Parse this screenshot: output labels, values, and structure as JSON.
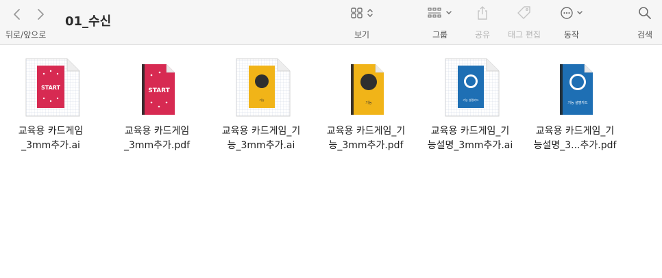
{
  "toolbar": {
    "nav_label": "뒤로/앞으로",
    "folder_title": "01_수신",
    "view_label": "보기",
    "group_label": "그룹",
    "share_label": "공유",
    "tags_label": "태그 편집",
    "action_label": "동작",
    "search_label": "검색"
  },
  "files": [
    {
      "line1": "교육용 카드게임",
      "line2": "_3mm추가.ai",
      "kind": "ai",
      "card_color": "#d72a52",
      "card_text": "START"
    },
    {
      "line1": "교육용 카드게임",
      "line2": "_3mm추가.pdf",
      "kind": "pdf",
      "card_color": "#d72a52",
      "card_text": "START"
    },
    {
      "line1": "교육용 카드게임_기",
      "line2": "능_3mm추가.ai",
      "kind": "ai",
      "card_color": "#f1b418",
      "card_text": "기능"
    },
    {
      "line1": "교육용 카드게임_기",
      "line2": "능_3mm추가.pdf",
      "kind": "pdf",
      "card_color": "#f1b418",
      "card_text": "기능"
    },
    {
      "line1": "교육용 카드게임_기",
      "line2": "능설명_3mm추가.ai",
      "kind": "ai",
      "card_color": "#1e6fb4",
      "card_text": "기능 설명카드"
    },
    {
      "line1": "교육용 카드게임_기",
      "line2": "능설명_3...추가.pdf",
      "kind": "pdf",
      "card_color": "#1e6fb4",
      "card_text": "기능 설명카드"
    }
  ],
  "colors": {
    "toolbar_bg": "#f6f6f6",
    "icon": "#7a7a7a",
    "icon_disabled": "#c4c4c4",
    "start_red": "#d72a52",
    "function_yellow": "#f1b418",
    "desc_blue": "#1e6fb4"
  }
}
